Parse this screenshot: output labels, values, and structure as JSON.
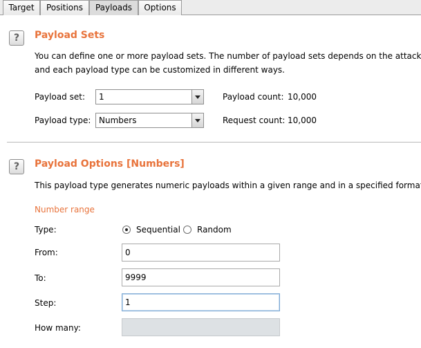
{
  "tabs": [
    "Target",
    "Positions",
    "Payloads",
    "Options"
  ],
  "active_tab": "Payloads",
  "payload_sets": {
    "help": "?",
    "title": "Payload Sets",
    "desc_line1": "You can define one or more payload sets. The number of payload sets depends on the attack typ",
    "desc_line2": "and each payload type can be customized in different ways.",
    "set_label": "Payload set:",
    "set_value": "1",
    "type_label": "Payload type:",
    "type_value": "Numbers",
    "count_label": "Payload count:",
    "count_value": "10,000",
    "request_label": "Request count:",
    "request_value": "10,000"
  },
  "payload_options": {
    "help": "?",
    "title": "Payload Options [Numbers]",
    "desc": "This payload type generates numeric payloads within a given range and in a specified format.",
    "number_range": "Number range",
    "type_label": "Type:",
    "sequential_label": "Sequential",
    "random_label": "Random",
    "selected_type": "Sequential",
    "from_label": "From:",
    "from_value": "0",
    "to_label": "To:",
    "to_value": "9999",
    "step_label": "Step:",
    "step_value": "1",
    "howmany_label": "How many:",
    "howmany_value": ""
  },
  "colors": {
    "accent": "#e8733b"
  }
}
